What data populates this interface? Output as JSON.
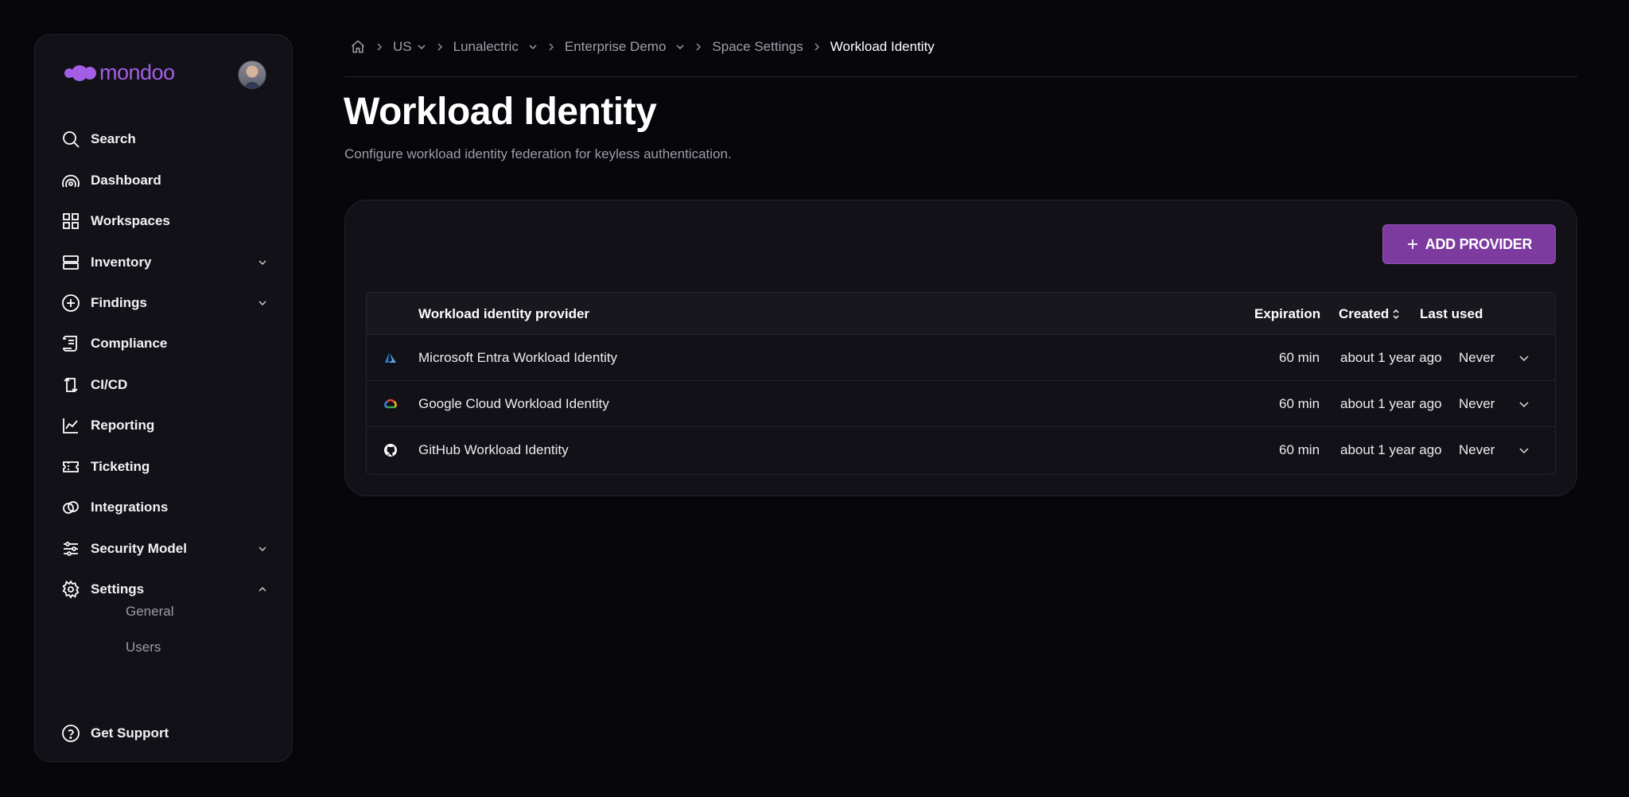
{
  "brand": {
    "logo_text": "mondoo",
    "accent": "#a45ee5"
  },
  "sidebar": {
    "items": [
      {
        "label": "Search",
        "icon": "search-icon"
      },
      {
        "label": "Dashboard",
        "icon": "dashboard-icon"
      },
      {
        "label": "Workspaces",
        "icon": "grid-icon"
      },
      {
        "label": "Inventory",
        "icon": "server-icon",
        "chevron": "down"
      },
      {
        "label": "Findings",
        "icon": "plus-circle-icon",
        "chevron": "down"
      },
      {
        "label": "Compliance",
        "icon": "scroll-icon"
      },
      {
        "label": "CI/CD",
        "icon": "cicd-icon"
      },
      {
        "label": "Reporting",
        "icon": "chart-icon"
      },
      {
        "label": "Ticketing",
        "icon": "ticket-icon"
      },
      {
        "label": "Integrations",
        "icon": "integrations-icon"
      },
      {
        "label": "Security Model",
        "icon": "sliders-icon",
        "chevron": "down"
      },
      {
        "label": "Settings",
        "icon": "gear-icon",
        "chevron": "up"
      }
    ],
    "settings_subitems": [
      "General",
      "Users"
    ],
    "support_label": "Get Support"
  },
  "breadcrumb": {
    "items": [
      "US",
      "Lunalectric",
      "Enterprise Demo",
      "Space Settings",
      "Workload Identity"
    ]
  },
  "page": {
    "title": "Workload Identity",
    "subtitle": "Configure workload identity federation for keyless authentication."
  },
  "add_button_label": "ADD PROVIDER",
  "table": {
    "columns": {
      "provider": "Workload identity provider",
      "expiration": "Expiration",
      "created": "Created",
      "last_used": "Last used"
    },
    "rows": [
      {
        "icon": "azure-icon",
        "provider": "Microsoft Entra Workload Identity",
        "expiration": "60 min",
        "created": "about 1 year ago",
        "last_used": "Never"
      },
      {
        "icon": "google-cloud-icon",
        "provider": "Google Cloud Workload Identity",
        "expiration": "60 min",
        "created": "about 1 year ago",
        "last_used": "Never"
      },
      {
        "icon": "github-icon",
        "provider": "GitHub Workload Identity",
        "expiration": "60 min",
        "created": "about 1 year ago",
        "last_used": "Never"
      }
    ]
  }
}
